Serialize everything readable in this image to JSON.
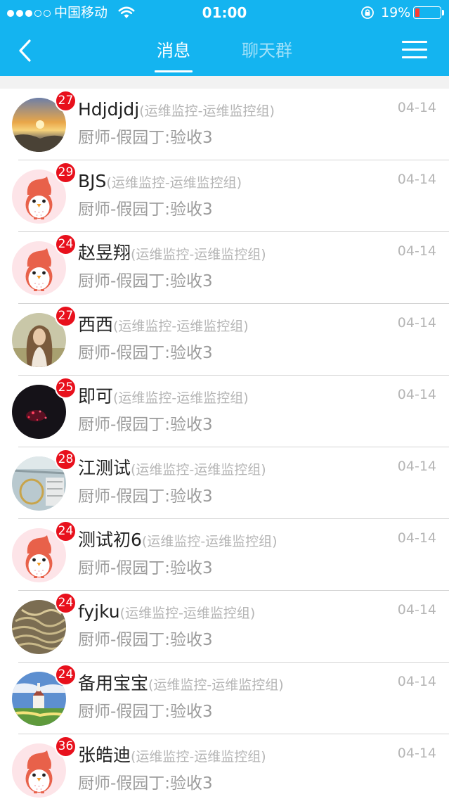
{
  "status_bar": {
    "carrier": "中国移动",
    "time": "01:00",
    "battery_percent": "19%",
    "battery_level": 0.19,
    "battery_color": "#ff3b30",
    "signal_bars_filled": 3,
    "signal_bars_total": 5
  },
  "nav": {
    "back_icon": "chevron-left-icon",
    "tabs": [
      {
        "label": "消息",
        "active": true
      },
      {
        "label": "聊天群",
        "active": false
      }
    ],
    "menu_icon": "hamburger-menu-icon"
  },
  "colors": {
    "header": "#14b4f0",
    "badge": "#e8101c",
    "divider": "#d4d4d4"
  },
  "conversations": [
    {
      "name": "Hdjdjdj",
      "group": "(运维监控-运维监控组)",
      "message": "厨师-假园丁:验收3",
      "date": "04-14",
      "unread": "27",
      "avatar": "sunset-photo"
    },
    {
      "name": "BJS",
      "group": "(运维监控-运维监控组)",
      "message": "厨师-假园丁:验收3",
      "date": "04-14",
      "unread": "29",
      "avatar": "default-bird-avatar"
    },
    {
      "name": "赵昱翔",
      "group": "(运维监控-运维监控组)",
      "message": "厨师-假园丁:验收3",
      "date": "04-14",
      "unread": "24",
      "avatar": "default-bird-avatar"
    },
    {
      "name": "西西",
      "group": "(运维监控-运维监控组)",
      "message": "厨师-假园丁:验收3",
      "date": "04-14",
      "unread": "27",
      "avatar": "portrait-photo"
    },
    {
      "name": "即可",
      "group": "(运维监控-运维监控组)",
      "message": "厨师-假园丁:验收3",
      "date": "04-14",
      "unread": "25",
      "avatar": "dark-photo"
    },
    {
      "name": "江测试",
      "group": "(运维监控-运维监控组)",
      "message": "厨师-假园丁:验收3",
      "date": "04-14",
      "unread": "28",
      "avatar": "window-photo"
    },
    {
      "name": "测试初6",
      "group": "(运维监控-运维监控组)",
      "message": "厨师-假园丁:验收3",
      "date": "04-14",
      "unread": "24",
      "avatar": "default-bird-avatar"
    },
    {
      "name": "fyjku",
      "group": "(运维监控-运维监控组)",
      "message": "厨师-假园丁:验收3",
      "date": "04-14",
      "unread": "24",
      "avatar": "noodles-photo"
    },
    {
      "name": "备用宝宝",
      "group": "(运维监控-运维监控组)",
      "message": "厨师-假园丁:验收3",
      "date": "04-14",
      "unread": "24",
      "avatar": "church-landscape-photo"
    },
    {
      "name": "张皓迪",
      "group": "(运维监控-运维监控组)",
      "message": "厨师-假园丁:验收3",
      "date": "04-14",
      "unread": "36",
      "avatar": "default-bird-avatar"
    }
  ]
}
